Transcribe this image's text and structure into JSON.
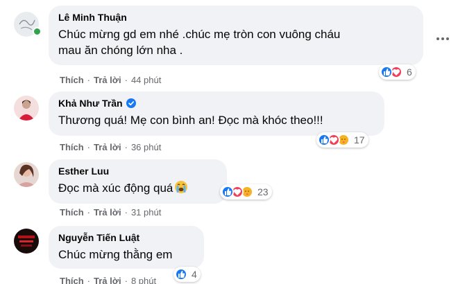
{
  "comments": [
    {
      "author": "Lê Minh Thuận",
      "text": "Chúc mừng gd em nhé .chúc mẹ tròn con vuông cháu\nmau ăn chóng lớn nha .",
      "reaction_count": "6",
      "reactions": [
        "like",
        "love"
      ],
      "like_label": "Thích",
      "reply_label": "Trả lời",
      "time": "44 phút",
      "online": true
    },
    {
      "author": "Khả Như Trần",
      "verified": true,
      "text": "Thương quá! Mẹ con bình an! Đọc mà khóc theo!!!",
      "reaction_count": "17",
      "reactions": [
        "like",
        "love",
        "care"
      ],
      "like_label": "Thích",
      "reply_label": "Trả lời",
      "time": "36 phút"
    },
    {
      "author": "Esther Luu",
      "text": "Đọc mà xúc động quá",
      "emoji": "crying-face",
      "reaction_count": "23",
      "reactions": [
        "like",
        "love",
        "care"
      ],
      "like_label": "Thích",
      "reply_label": "Trả lời",
      "time": "31 phút"
    },
    {
      "author": "Nguyễn Tiến Luật",
      "text": "Chúc mừng thằng em",
      "reaction_count": "4",
      "reactions": [
        "like"
      ],
      "like_label": "Thích",
      "reply_label": "Trả lời",
      "time": "8 phút"
    }
  ],
  "colors": {
    "bubble": "#f0f2f5",
    "meta_text": "#65676b",
    "like": "#1877f2",
    "love": "#f33e58",
    "care": "#f7b125",
    "online": "#31a24c"
  }
}
